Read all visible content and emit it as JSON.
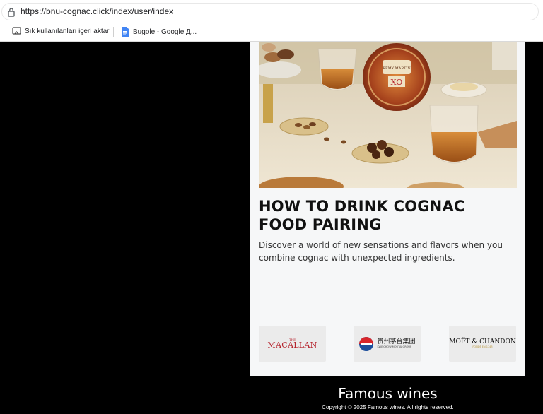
{
  "browser": {
    "url": "https://bnu-cognac.click/index/user/index",
    "bookmarks": [
      {
        "label": "Sık kullanılanları içeri aktar",
        "icon": "import-bookmarks-icon"
      },
      {
        "label": "Bugole - Google Д...",
        "icon": "google-docs-icon"
      }
    ]
  },
  "article": {
    "hero_image_alt_bottle_label": "XO",
    "hero_image_brand": "RÉMY MARTIN",
    "title": "HOW TO DRINK COGNAC FOOD PAIRING",
    "description": "Discover a world of new sensations and flavors when you combine cognac with unexpected ingredients."
  },
  "partners": [
    {
      "name": "MACALLAN",
      "small": "THE"
    },
    {
      "name": "贵州茅台集团",
      "small": "KWEICHOW MOUTAI GROUP"
    },
    {
      "name": "MOËT & CHANDON",
      "small": "FONDÉ EN 1743"
    }
  ],
  "footer": {
    "title": "Famous wines",
    "copyright": "Copyright © 2025 Famous wines. All rights reserved."
  },
  "colors": {
    "page_bg": "#000000",
    "card_bg": "#f6f7f8",
    "macallan_red": "#b4202a",
    "moutai_blue": "#1d4f9c"
  }
}
